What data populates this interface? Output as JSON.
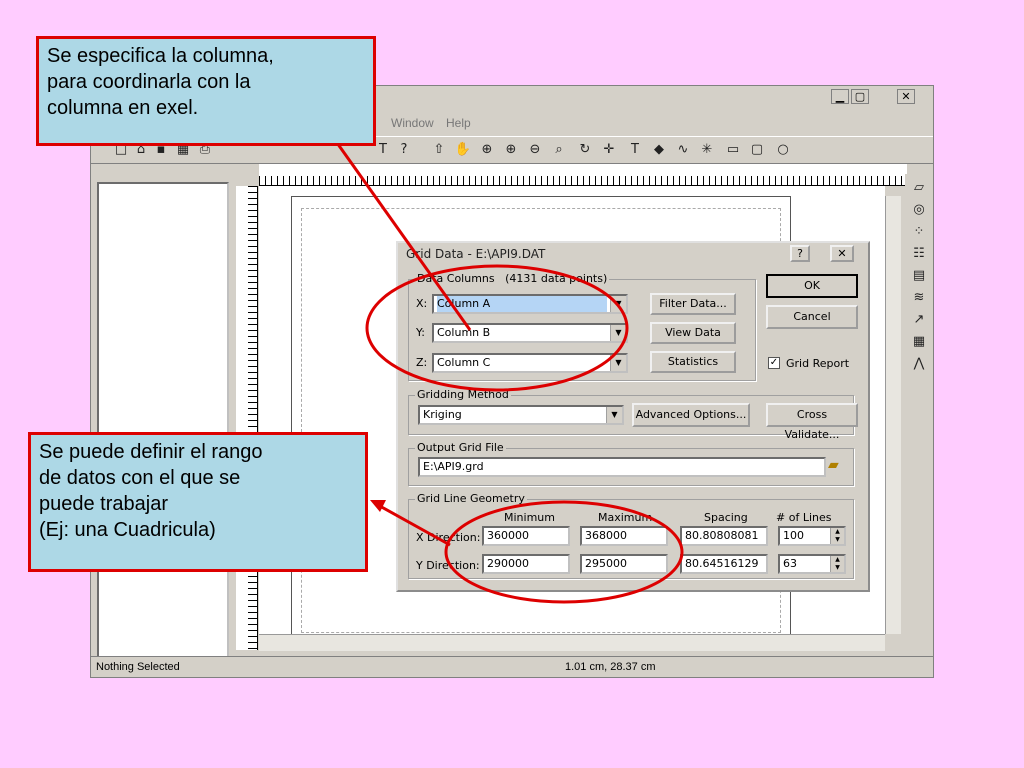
{
  "menu": {
    "window": "Window",
    "help": "Help"
  },
  "window_controls": {
    "minimize": "▁",
    "restore": "▢",
    "close": "✕"
  },
  "status": {
    "left": "Nothing Selected",
    "coords": "1.01 cm, 28.37 cm"
  },
  "dialog": {
    "title": "Grid Data - E:\\API9.DAT",
    "help_button": "?",
    "close_button": "✕",
    "data_columns": {
      "legend": "Data Columns",
      "count": "(4131 data points)",
      "x_label": "X:",
      "x_value": "Column A",
      "y_label": "Y:",
      "y_value": "Column B",
      "z_label": "Z:",
      "z_value": "Column C",
      "filter_button": "Filter Data...",
      "view_button": "View Data",
      "statistics_button": "Statistics"
    },
    "ok_button": "OK",
    "cancel_button": "Cancel",
    "grid_report_label": "Grid Report",
    "grid_report_checked": true,
    "gridding_method": {
      "legend": "Gridding Method",
      "value": "Kriging",
      "advanced_button": "Advanced Options...",
      "cross_validate_button": "Cross Validate..."
    },
    "output": {
      "legend": "Output Grid File",
      "value": "E:\\API9.grd"
    },
    "geometry": {
      "legend": "Grid Line Geometry",
      "col_min": "Minimum",
      "col_max": "Maximum",
      "col_spacing": "Spacing",
      "col_lines": "# of Lines",
      "x_label": "X Direction:",
      "x_min": "360000",
      "x_max": "368000",
      "x_spacing": "80.80808081",
      "x_lines": "100",
      "y_label": "Y Direction:",
      "y_min": "290000",
      "y_max": "295000",
      "y_spacing": "80.64516129",
      "y_lines": "63"
    }
  },
  "callouts": {
    "top": [
      "Se especifica la columna,",
      "para coordinarla con la",
      "columna en exel."
    ],
    "bottom": [
      "Se puede definir el rango",
      "de datos con  el que se",
      "puede trabajar",
      "(Ej: una Cuadricula)"
    ]
  },
  "colors": {
    "background": "#ffccff",
    "callout_fill": "#add8e6",
    "callout_border": "#dd0000",
    "annotation": "#dd0000"
  }
}
